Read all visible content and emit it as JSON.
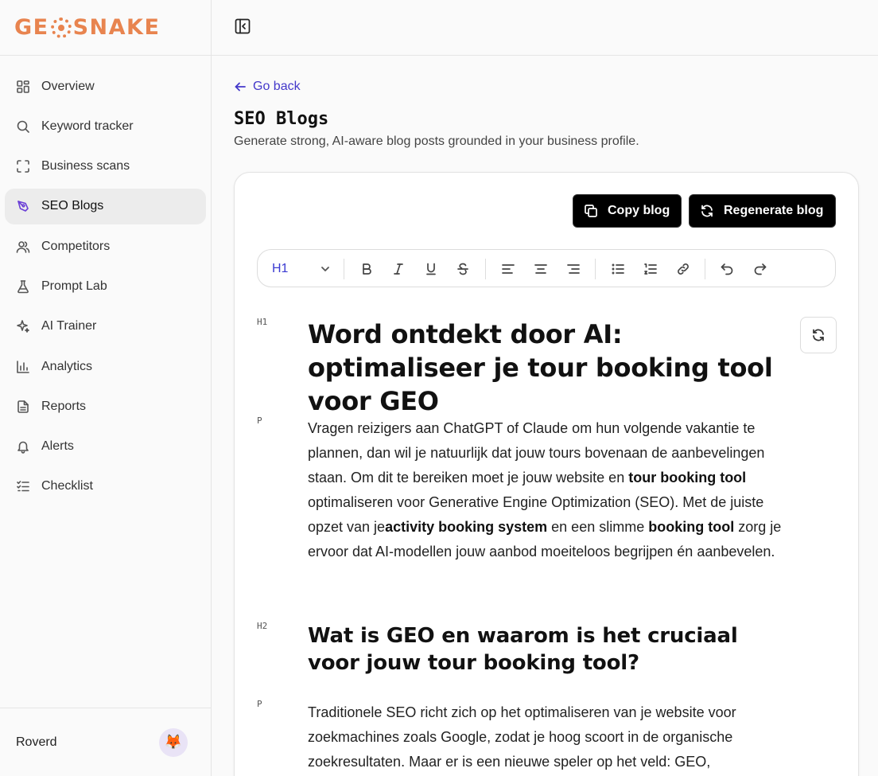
{
  "brand": {
    "logo_left": "GE",
    "logo_right": "SNAKE",
    "color": "#e8844f"
  },
  "sidebar": {
    "items": [
      {
        "label": "Overview",
        "icon": "grid-icon"
      },
      {
        "label": "Keyword tracker",
        "icon": "search-icon"
      },
      {
        "label": "Business scans",
        "icon": "scan-frame-icon"
      },
      {
        "label": "SEO Blogs",
        "icon": "pen-nib-icon",
        "active": true
      },
      {
        "label": "Competitors",
        "icon": "users-icon"
      },
      {
        "label": "Prompt Lab",
        "icon": "flask-icon"
      },
      {
        "label": "AI Trainer",
        "icon": "sparkles-icon"
      },
      {
        "label": "Analytics",
        "icon": "bar-chart-icon"
      },
      {
        "label": "Reports",
        "icon": "document-icon"
      },
      {
        "label": "Alerts",
        "icon": "bell-icon"
      },
      {
        "label": "Checklist",
        "icon": "checklist-icon"
      }
    ],
    "user": {
      "name": "Roverd",
      "avatar": "🦊"
    }
  },
  "header": {
    "go_back": "Go back",
    "title": "SEO Blogs",
    "subtitle": "Generate strong, AI-aware blog posts grounded in your business profile."
  },
  "actions": {
    "copy": "Copy blog",
    "regenerate": "Regenerate blog"
  },
  "editor": {
    "heading_level": "H1",
    "blocks": {
      "h1_tag": "H1",
      "h1": "Word ontdekt door AI: optimaliseer je tour booking tool voor GEO",
      "p1_tag": "P",
      "p1": {
        "t1": "Vragen reizigers aan ChatGPT of Claude om hun volgende vakantie te plannen, dan wil je natuurlijk dat jouw tours bovenaan de aanbevelingen staan. Om dit te bereiken moet je jouw website en ",
        "b1": "tour booking tool",
        "t2": " optimaliseren voor Generative Engine Optimization (SEO). Met de juiste opzet van je",
        "b2": "activity booking system",
        "t3": " en een slimme ",
        "b3": "booking tool",
        "t4": " zorg je ervoor dat AI-modellen jouw aanbod moeiteloos begrijpen én aanbevelen."
      },
      "h2_tag": "H2",
      "h2": "Wat is GEO en waarom is het cruciaal voor jouw tour booking tool?",
      "p2_tag": "P",
      "p2": "Traditionele SEO richt zich op het optimaliseren van je website voor zoekmachines zoals Google, zodat je hoog scoort in de organische zoekresultaten. Maar er is een nieuwe speler op het veld: GEO,"
    }
  }
}
